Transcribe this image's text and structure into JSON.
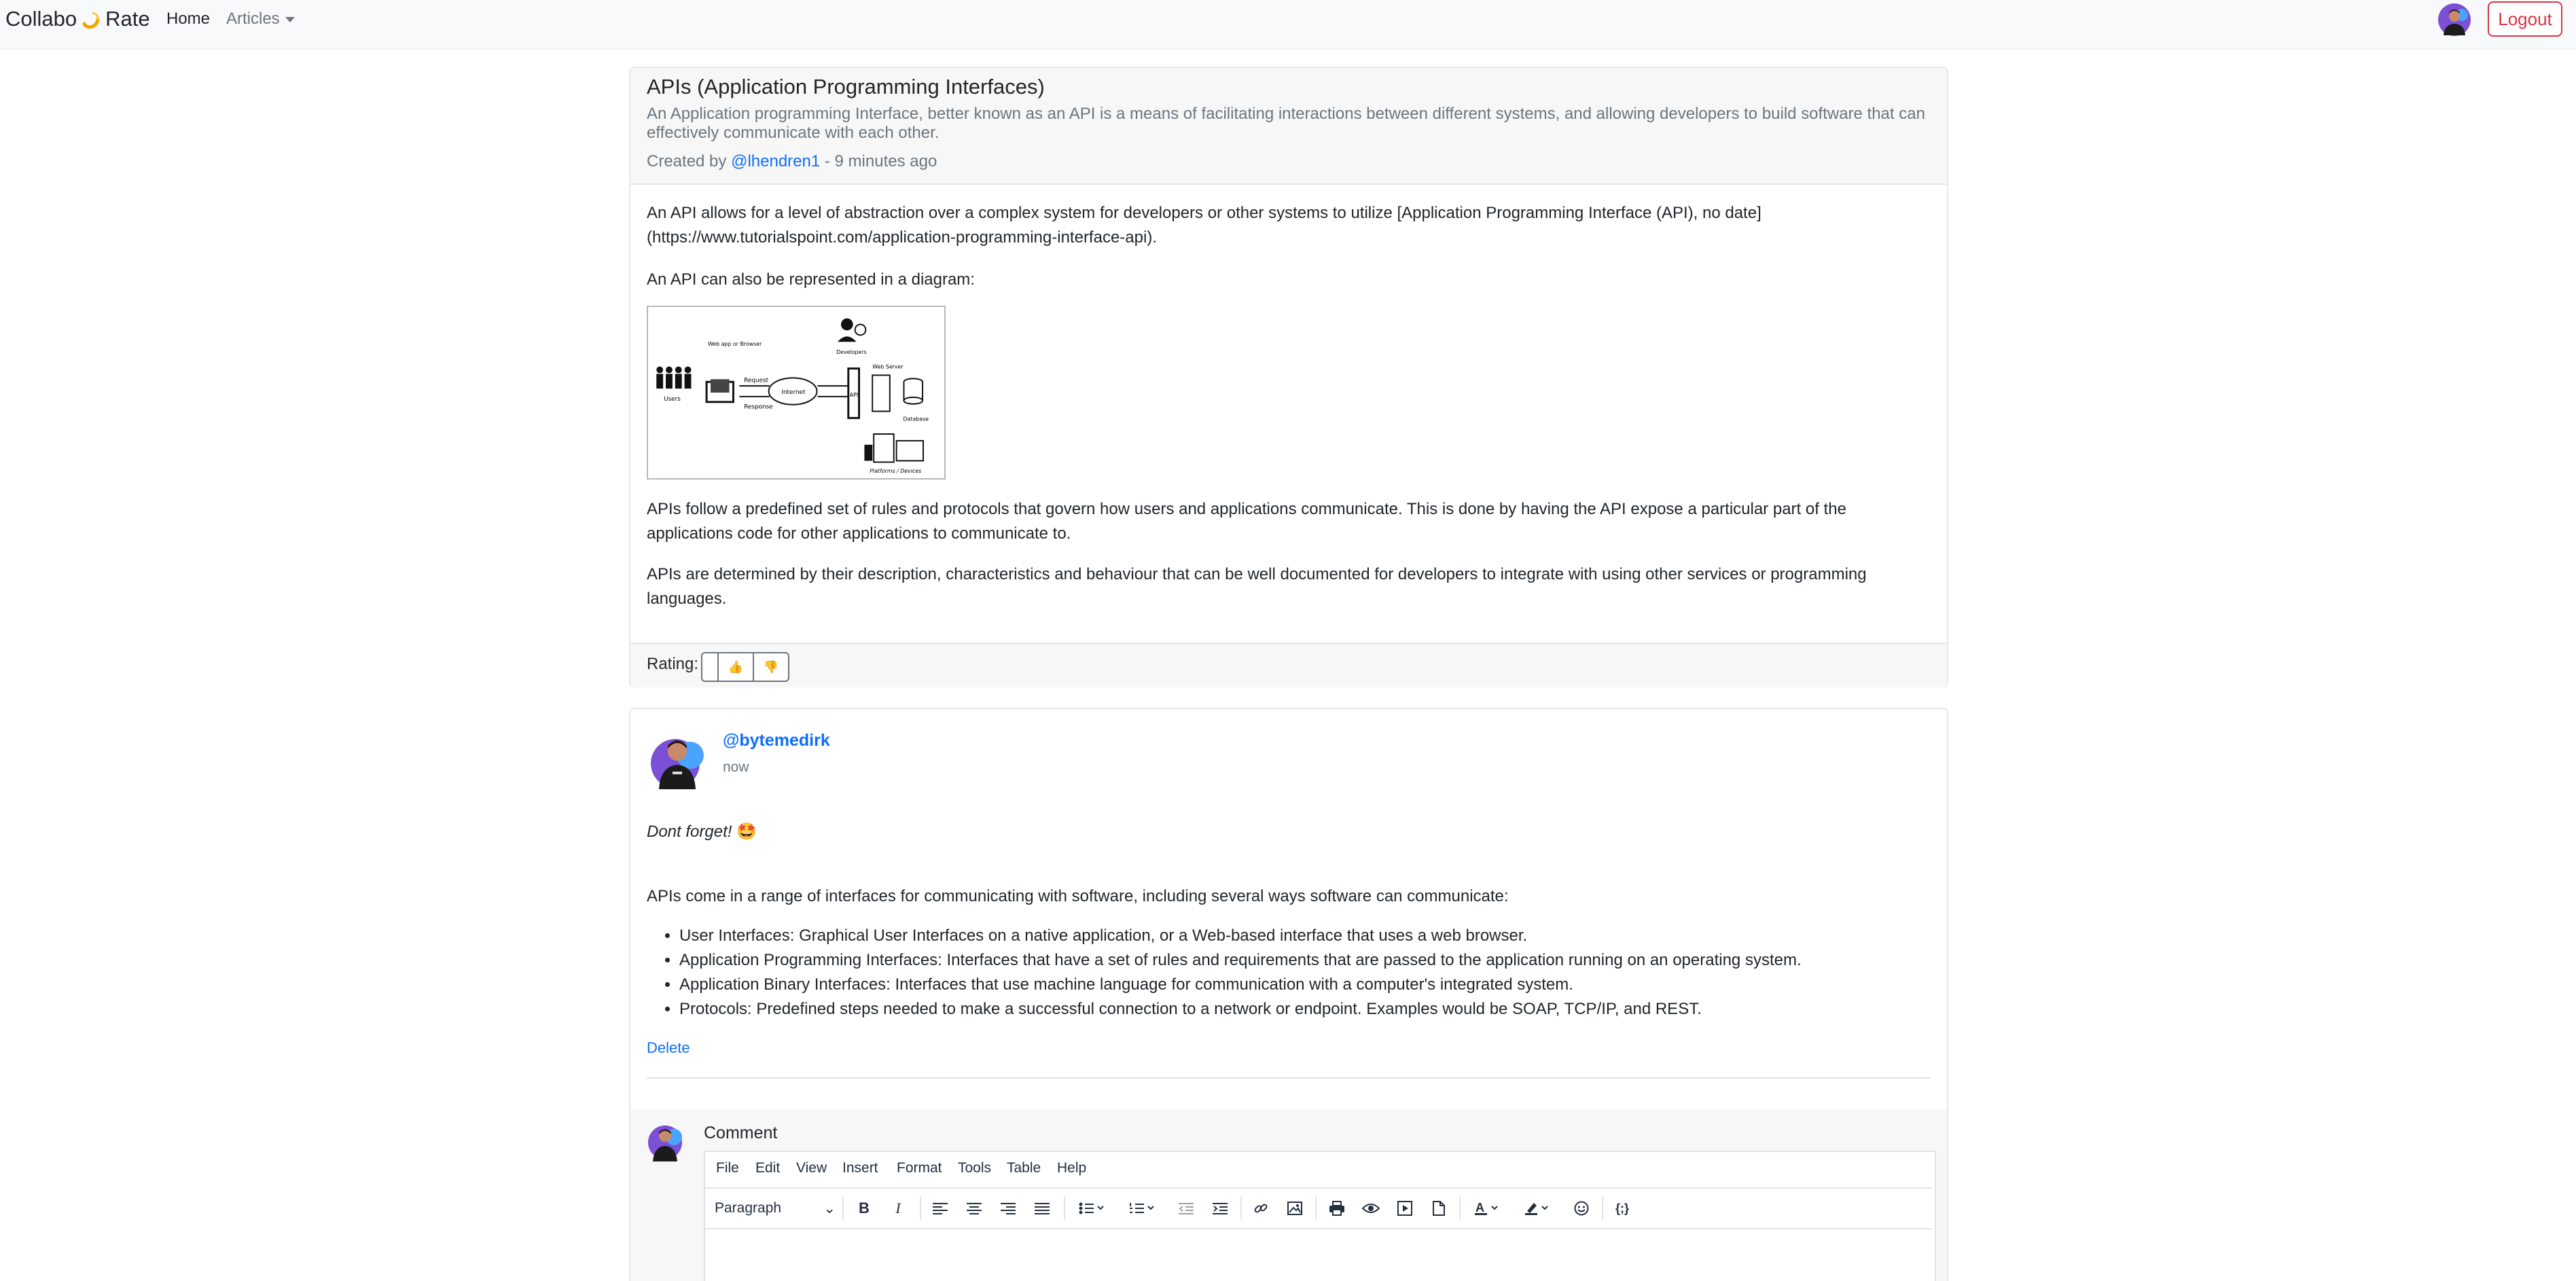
{
  "nav": {
    "brand_left": "Collabo",
    "brand_right": "Rate",
    "home": "Home",
    "articles": "Articles",
    "logout": "Logout"
  },
  "article": {
    "title": "APIs (Application Programming Interfaces)",
    "summary": "An Application programming Interface, better known as an API is a means of facilitating interactions between different systems, and allowing developers to build software that can effectively communicate with each other.",
    "created_prefix": "Created by",
    "author": "@lhendren1",
    "created_suffix": "- 9 minutes ago",
    "p1": "An API allows for a level of abstraction over a complex system for developers or other systems to utilize [Application Programming Interface (API), no date](https://www.tutorialspoint.com/application-programming-interface-api).",
    "p2": "An API can also be represented in a diagram:",
    "p3": "APIs follow a predefined set of rules and protocols that govern how users and applications communicate. This is done by having the API expose a particular part of the applications code for other applications to communicate to.",
    "p4": "APIs are determined by their description, characteristics and behaviour that can be well documented for developers to integrate with using other services or programming languages.",
    "diagram": {
      "users": "Users",
      "web_app": "Web app or Browser",
      "request": "Request",
      "response": "Response",
      "internet": "Internet",
      "api": "API",
      "developers": "Developers",
      "web_server": "Web Server",
      "database": "Database",
      "platforms": "Platforms / Devices"
    },
    "rating_label": "Rating:",
    "thumbs_up": "👍",
    "thumbs_down": "👎"
  },
  "comment": {
    "user": "@bytemedirk",
    "time": "now",
    "italic_text": "Dont forget!",
    "emoji": "🤩",
    "intro": "APIs come in a range of interfaces for communicating with software, including several ways software can communicate:",
    "items": [
      "User Interfaces: Graphical User Interfaces on a native application, or a Web-based interface that uses a web browser.",
      "Application Programming Interfaces: Interfaces that have a set of rules and requirements that are passed to the application running on an operating system.",
      "Application Binary Interfaces: Interfaces that use machine language for communication with a computer's integrated system.",
      "Protocols: Predefined steps needed to make a successful connection to a network or endpoint. Examples would be SOAP, TCP/IP, and REST."
    ],
    "delete": "Delete"
  },
  "form": {
    "label": "Comment",
    "menus": [
      "File",
      "Edit",
      "View",
      "Insert",
      "Format",
      "Tools",
      "Table",
      "Help"
    ],
    "block_format": "Paragraph"
  },
  "colors": {
    "link": "#0d6efd",
    "danger": "#dc3545",
    "muted": "#6c757d",
    "accent_logo": "#f0a500"
  }
}
